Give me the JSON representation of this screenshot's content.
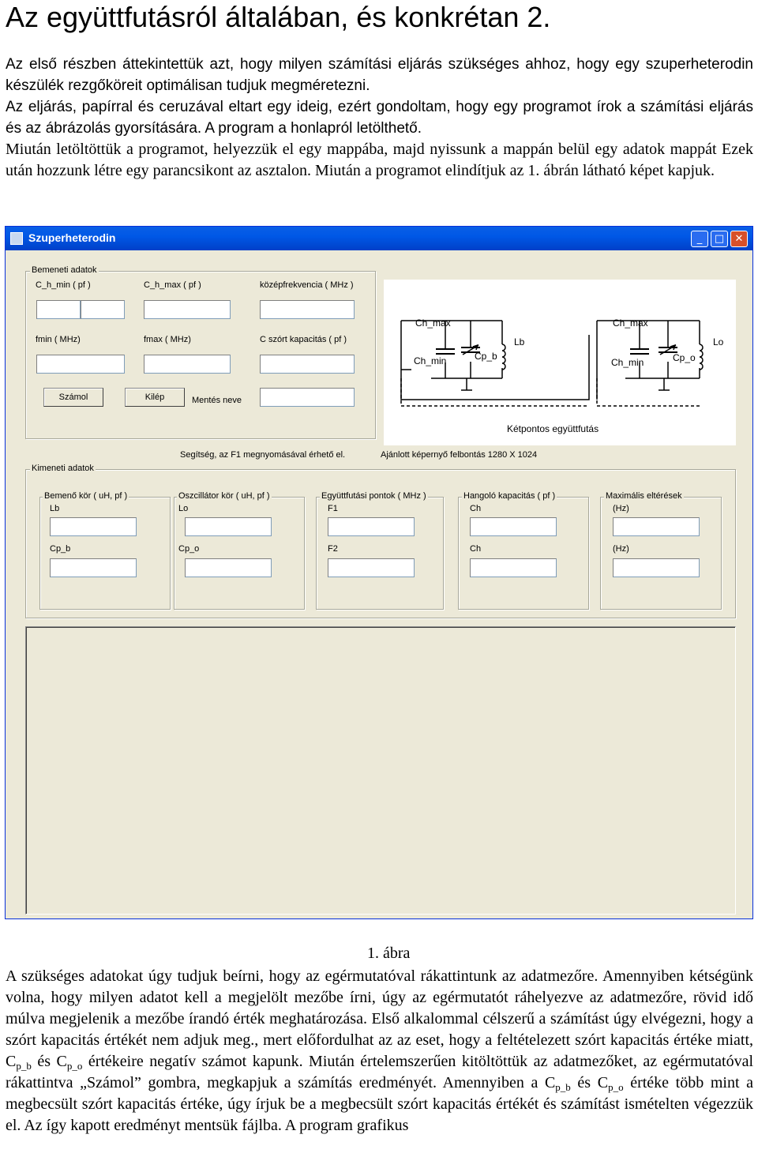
{
  "doc": {
    "title": "Az együttfutásról általában, és konkrétan 2.",
    "intro": [
      "Az első részben áttekintettük azt, hogy milyen számítási eljárás szükséges ahhoz, hogy egy szuperheterodin készülék rezgőköreit optimálisan tudjuk megméretezni.",
      "Az eljárás, papírral és ceruzával eltart egy ideig, ezért gondoltam, hogy egy programot írok a számítási eljárás és az ábrázolás gyorsítására. A program a honlapról letölthető.",
      "Miután letöltöttük a programot, helyezzük el egy mappába, majd nyissunk a mappán belül egy adatok mappát Ezek után hozzunk létre egy parancsikont az asztalon. Miután a programot elindítjuk az 1. ábrán látható képet kapjuk."
    ],
    "caption": "1.   ábra",
    "bottom_1": "A szükséges adatokat úgy tudjuk beírni, hogy az egérmutatóval rákattintunk az adatmezőre. Amennyiben kétségünk volna, hogy milyen adatot kell a megjelölt mezőbe írni, úgy az egérmutatót ráhelyezve az adatmezőre, rövid idő múlva megjelenik a mezőbe írandó érték meghatározása. Első alkalommal célszerű a számítást úgy elvégezni, hogy a szórt kapacitás értékét nem adjuk meg., mert előfordulhat az az eset, hogy a feltételezett szórt kapacitás értéke miatt,",
    "bottom_C": "C",
    "bottom_sub_pb": "p_b",
    "bottom_es": "és",
    "bottom_sub_po": "p_o",
    "bottom_2": "értékeire negatív számot kapunk. Miután értelemszerűen kitöltöttük az adatmezőket, az egérmutatóval rákattintva „Számol” gombra, megkapjuk a számítás eredményét. Amennyiben a",
    "bottom_3": "értéke több mint a megbecsült szórt kapacitás értéke, úgy írjuk be a megbecsült szórt kapacitás értékét és számítást ismételten végezzük el.  Az így kapott eredményt mentsük fájlba. A program grafikus"
  },
  "window": {
    "title": "Szuperheterodin",
    "minimize_icon": "_",
    "maximize_icon": "□",
    "close_icon": "✕",
    "input_group": {
      "label": "Bemeneti adatok",
      "c_h_min": "C_h_min ( pf )",
      "c_h_max": "C_h_max ( pf )",
      "kozepfrekvencia": "középfrekvencia ( MHz )",
      "fmin": "fmin ( MHz)",
      "fmax": "fmax ( MHz)",
      "c_szort": "C szórt kapacitás ( pf )",
      "calc_button": "Számol",
      "exit_button": "Kilép",
      "save_name": "Mentés neve"
    },
    "circuit": {
      "left_ch_max": "Ch_max",
      "left_ch_min": "Ch_min",
      "left_cp": "Cp_b",
      "left_l": "Lb",
      "right_ch_max": "Ch_max",
      "right_ch_min": "Ch_min",
      "right_cp": "Cp_o",
      "right_l": "Lo",
      "caption": "Kétpontos együttfutás"
    },
    "help_text": "Segítség, az F1 megnyomásával érhető el.",
    "resolution_text": "Ajánlott képernyő felbontás 1280 X 1024",
    "output_group": {
      "label": "Kimeneti adatok",
      "boxes": [
        {
          "title": "Bemenő kör ( uH, pf )",
          "l1": "Lb",
          "l2": "Cp_b"
        },
        {
          "title": "Oszcillátor kör ( uH, pf )",
          "l1": "Lo",
          "l2": "Cp_o"
        },
        {
          "title": "Együttfutási pontok ( MHz )",
          "l1": "F1",
          "l2": "F2"
        },
        {
          "title": "Hangoló kapacitás ( pf )",
          "l1": "Ch",
          "l2": "Ch"
        },
        {
          "title": "Maximális eltérések",
          "l1": "(Hz)",
          "l2": "(Hz)"
        }
      ]
    }
  }
}
